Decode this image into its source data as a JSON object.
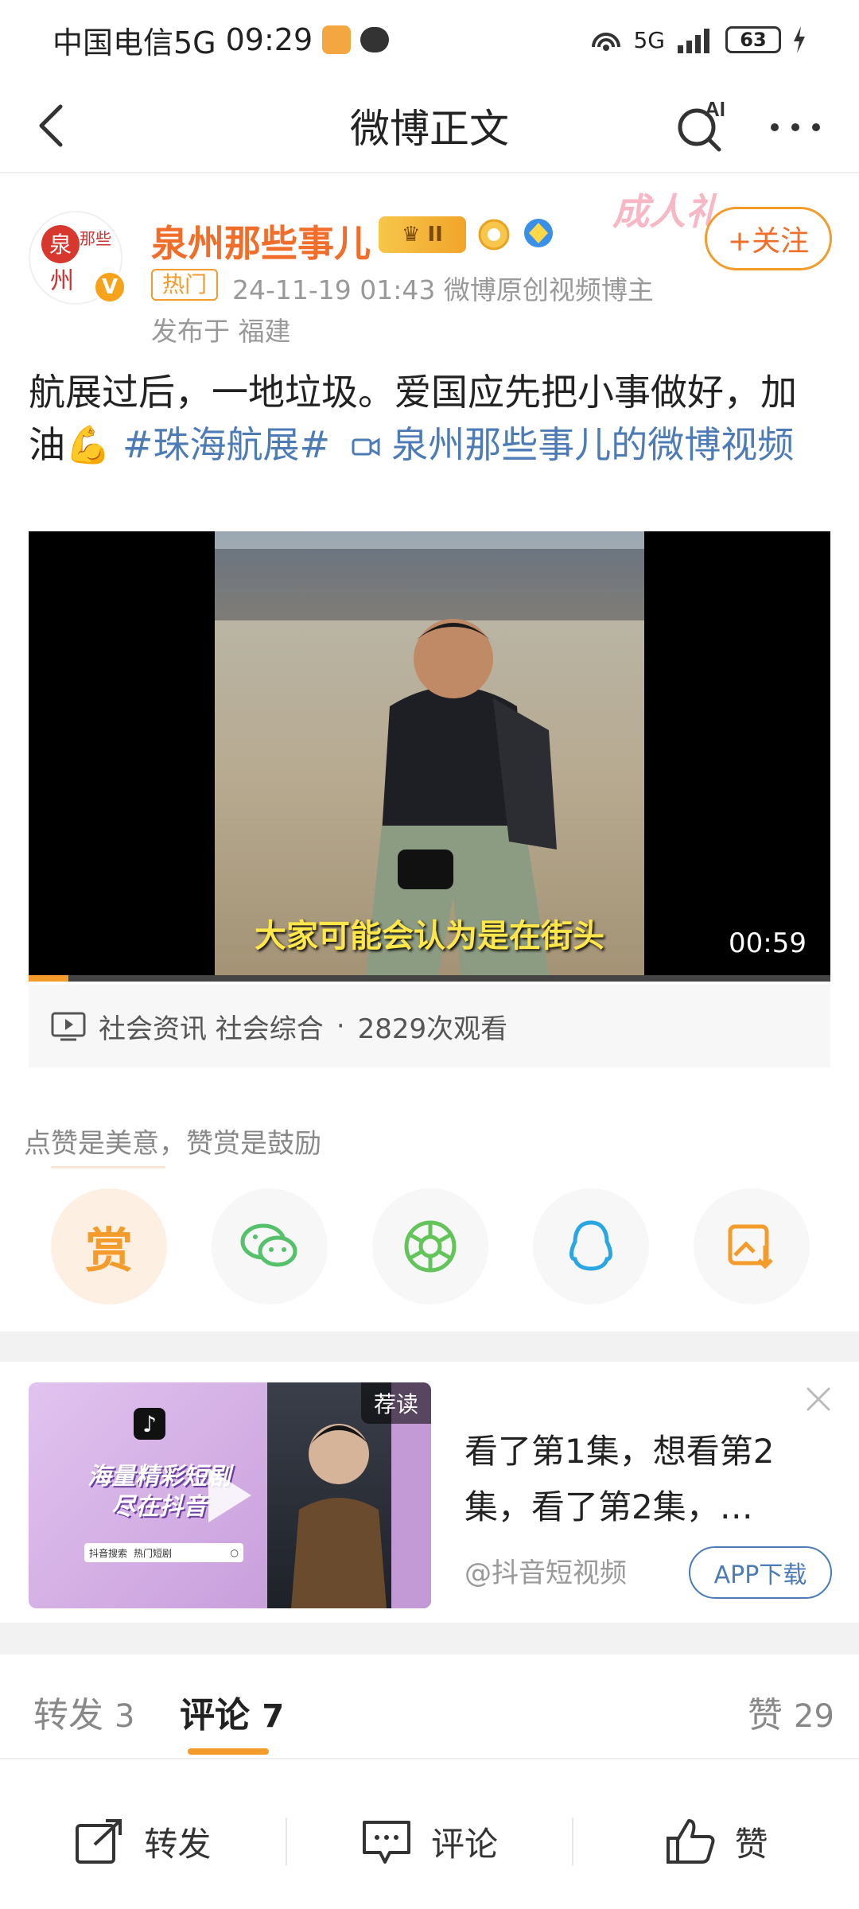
{
  "status_bar": {
    "carrier": "中国电信5G",
    "time": "09:29",
    "network": "5G",
    "battery": "63"
  },
  "nav": {
    "title": "微博正文",
    "ai_label": "AI"
  },
  "post": {
    "author": "泉州那些事儿",
    "avatar_text": "泉 那些事 州",
    "verified_badge": "V",
    "level_badge": "II",
    "hot_tag": "热门",
    "meta": "24-11-19 01:43  微博原创视频博主",
    "location": "发布于 福建",
    "adult_badge": "成人礼",
    "follow_label": "+关注",
    "text": "航展过后，一地垃圾。爱国应先把小事做好，加油💪 ",
    "hashtag": "#珠海航展#",
    "video_link": " 泉州那些事儿的微博视频"
  },
  "video": {
    "subtitle": "大家可能会认为是在街头",
    "duration": "00:59",
    "progress": 0.05
  },
  "video_info": {
    "category": "社会资讯 社会综合",
    "separator": "·",
    "views": "2829次观看"
  },
  "reward": {
    "hint": "点赞是美意，赞赏是鼓励",
    "button_label": "赏"
  },
  "share_icons": [
    "wechat-icon",
    "moments-icon",
    "qq-icon",
    "save-image-icon"
  ],
  "ad": {
    "recommend_tag": "荐读",
    "slogan": "海量精彩短剧 尽在抖音",
    "searchbar_left": "抖音搜索",
    "searchbar_right": "热门短剧",
    "title": "看了第1集，想看第2集，看了第2集，…",
    "source": "@抖音短视频",
    "download_label": "APP下载"
  },
  "tabs": {
    "repost_label": "转发",
    "repost_count": "3",
    "comment_label": "评论",
    "comment_count": "7",
    "like_label": "赞",
    "like_count": "29"
  },
  "bottom_bar": {
    "repost": "转发",
    "comment": "评论",
    "like": "赞"
  },
  "colors": {
    "accent": "#f39b2b",
    "author": "#f06d2a",
    "link": "#4d7bb6"
  }
}
